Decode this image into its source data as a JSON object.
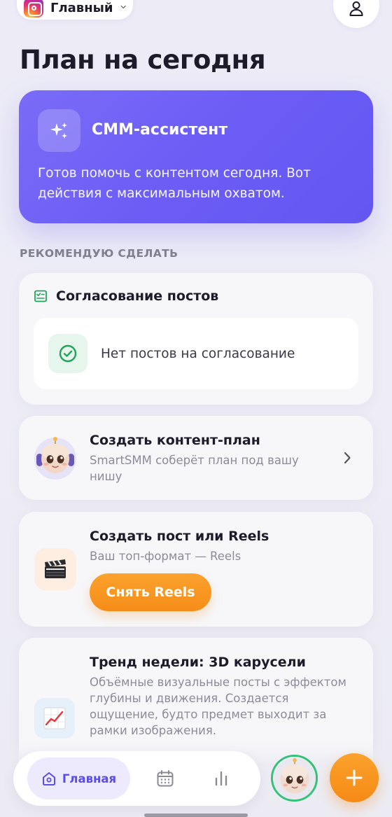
{
  "header": {
    "account_name": "Главный",
    "page_title": "План на сегодня"
  },
  "assistant": {
    "title": "СММ-ассистент",
    "text": "Готов помочь с контентом сегодня. Вот действия с максимальным охватом."
  },
  "section_label": "РЕКОМЕНДУЮ СДЕЛАТЬ",
  "approval": {
    "title": "Согласование постов",
    "empty_text": "Нет постов на согласование"
  },
  "content_plan": {
    "title": "Создать контент-план",
    "subtitle": "SmartSMM соберёт план под вашу нишу"
  },
  "post": {
    "title": "Создать пост или Reels",
    "subtitle": "Ваш топ-формат — Reels",
    "button_label": "Снять Reels"
  },
  "trend": {
    "title": "Тренд недели: 3D карусели",
    "text": "Объёмные визуальные посты с эффектом глубины и движения. Создается ощущение, будто предмет выходит за рамки изображения."
  },
  "nav": {
    "home_label": "Главная"
  },
  "colors": {
    "accent_purple": "#6a5cf5",
    "accent_orange": "#f58d18",
    "success_green": "#34c27a"
  }
}
